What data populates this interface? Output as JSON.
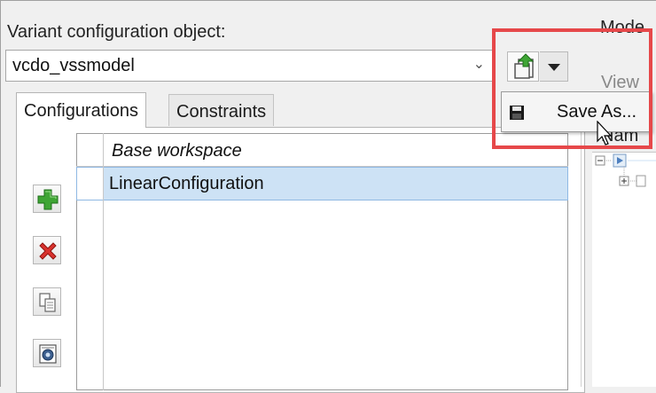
{
  "variant_config": {
    "label": "Variant configuration object:",
    "selected_value": "vcdo_vssmodel"
  },
  "tabs": [
    {
      "label": "Configurations",
      "active": true
    },
    {
      "label": "Constraints",
      "active": false
    }
  ],
  "table": {
    "column_header": "Base workspace",
    "rows": [
      {
        "name": "LinearConfiguration",
        "selected": true
      }
    ]
  },
  "side_buttons": [
    {
      "icon": "plus-icon"
    },
    {
      "icon": "delete-icon"
    },
    {
      "icon": "copy-icon"
    },
    {
      "icon": "activate-icon"
    }
  ],
  "export_menu": {
    "items": [
      {
        "label": "Save As...",
        "icon": "floppy-disk-icon"
      }
    ]
  },
  "right_panel": {
    "title_fragment": "Mode",
    "view_fragment": "View",
    "name_header_fragment": "Nam"
  },
  "colors": {
    "highlight": "#e6484a",
    "selection_bg": "#cde2f5",
    "add_green": "#3fa535",
    "delete_red": "#d9322e"
  }
}
